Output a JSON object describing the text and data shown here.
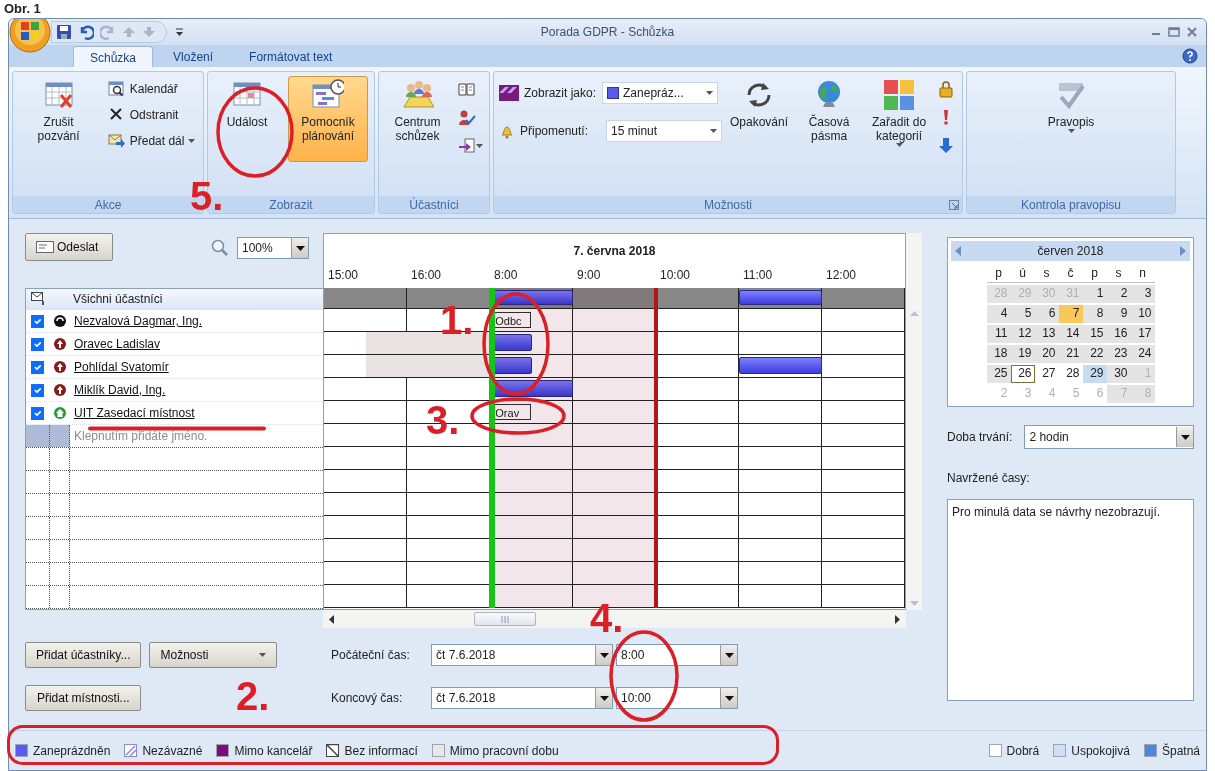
{
  "caption": "Obr. 1",
  "window": {
    "title": "Porada GDPR - Schůzka"
  },
  "tabs": [
    {
      "label": "Schůzka",
      "selected": true
    },
    {
      "label": "Vložení",
      "selected": false
    },
    {
      "label": "Formátovat text",
      "selected": false
    }
  ],
  "ribbon": {
    "groups": [
      {
        "label": "Akce",
        "items": [
          {
            "kind": "large",
            "label": "Zrušit pozvání"
          },
          {
            "kind": "small",
            "label": "Kalendář"
          },
          {
            "kind": "small",
            "label": "Odstranit"
          },
          {
            "kind": "small-split",
            "label": "Předat dál"
          }
        ]
      },
      {
        "label": "Zobrazit",
        "items": [
          {
            "kind": "large",
            "label": "Událost",
            "selected": false
          },
          {
            "kind": "large",
            "label": "Pomocník plánování",
            "selected": true
          }
        ]
      },
      {
        "label": "Účastníci",
        "items": [
          {
            "kind": "large",
            "label": "Centrum schůzek"
          },
          {
            "kind": "icon"
          },
          {
            "kind": "icon"
          },
          {
            "kind": "icon-split"
          }
        ]
      },
      {
        "label": "Možnosti",
        "items": [
          {
            "kind": "combo",
            "label": "Zobrazit jako:",
            "value": "Zanepráz..."
          },
          {
            "kind": "combo",
            "label": "Připomenutí:",
            "value": "15 minut"
          },
          {
            "kind": "large",
            "label": "Opakování"
          },
          {
            "kind": "large",
            "label": "Časová pásma"
          },
          {
            "kind": "large-split",
            "label": "Zařadit do kategorií"
          },
          {
            "kind": "icon"
          },
          {
            "kind": "icon"
          },
          {
            "kind": "icon"
          }
        ]
      },
      {
        "label": "Kontrola pravopisu",
        "items": [
          {
            "kind": "large-split",
            "label": "Pravopis"
          }
        ]
      }
    ]
  },
  "send_button": "Odeslat",
  "zoom": "100%",
  "attendees": {
    "header": "Všichni účastníci",
    "placeholder": "Klepnutím přidáte jméno.",
    "items": [
      {
        "name": "Nezvalová Dagmar, Ing.",
        "kind": "organizer",
        "checked": true
      },
      {
        "name": "Oravec Ladislav",
        "kind": "required",
        "checked": true
      },
      {
        "name": "Pohlídal Svatomír",
        "kind": "required",
        "checked": true
      },
      {
        "name": "Miklík David, Ing.",
        "kind": "required",
        "checked": true
      },
      {
        "name": "UIT Zasedací místnost",
        "kind": "resource",
        "checked": true
      }
    ]
  },
  "timeline": {
    "date": "7. června 2018",
    "hours": [
      "15:00",
      "16:00",
      "8:00",
      "9:00",
      "10:00",
      "11:00",
      "12:00"
    ],
    "rows": [
      {
        "kind": "all",
        "slots": [
          {
            "kind": "free"
          },
          {
            "kind": "free"
          },
          {
            "kind": "free"
          },
          {
            "kind": "free"
          },
          {
            "kind": "busy"
          },
          {
            "kind": "busy"
          },
          {
            "kind": "free"
          },
          {
            "kind": "free"
          },
          {
            "kind": "free"
          },
          {
            "kind": "free"
          },
          {
            "kind": "busy"
          },
          {
            "kind": "busy"
          },
          {
            "kind": "free"
          },
          {
            "kind": "free"
          }
        ]
      },
      {
        "kind": "attendee",
        "label": "Odbc",
        "slots": [
          {
            "kind": "free"
          },
          {
            "kind": "free"
          },
          {
            "kind": "free"
          },
          {
            "kind": "free"
          },
          {
            "kind": "label"
          },
          {
            "kind": "free"
          },
          {
            "kind": "free"
          },
          {
            "kind": "free"
          },
          {
            "kind": "free"
          },
          {
            "kind": "free"
          },
          {
            "kind": "free"
          },
          {
            "kind": "free"
          },
          {
            "kind": "free"
          },
          {
            "kind": "free"
          }
        ]
      },
      {
        "kind": "attendee",
        "slots": [
          {
            "kind": "free"
          },
          {
            "kind": "off"
          },
          {
            "kind": "off"
          },
          {
            "kind": "off"
          },
          {
            "kind": "busy"
          },
          {
            "kind": "free"
          },
          {
            "kind": "free"
          },
          {
            "kind": "free"
          },
          {
            "kind": "free"
          },
          {
            "kind": "free"
          },
          {
            "kind": "free"
          },
          {
            "kind": "free"
          },
          {
            "kind": "free"
          },
          {
            "kind": "free"
          }
        ]
      },
      {
        "kind": "attendee",
        "slots": [
          {
            "kind": "free"
          },
          {
            "kind": "off"
          },
          {
            "kind": "off"
          },
          {
            "kind": "off"
          },
          {
            "kind": "busy"
          },
          {
            "kind": "free"
          },
          {
            "kind": "free"
          },
          {
            "kind": "free"
          },
          {
            "kind": "free"
          },
          {
            "kind": "free"
          },
          {
            "kind": "busy"
          },
          {
            "kind": "busy"
          },
          {
            "kind": "free"
          },
          {
            "kind": "free"
          }
        ]
      },
      {
        "kind": "attendee",
        "slots": [
          {
            "kind": "free"
          },
          {
            "kind": "free"
          },
          {
            "kind": "free"
          },
          {
            "kind": "free"
          },
          {
            "kind": "busy"
          },
          {
            "kind": "busy"
          },
          {
            "kind": "free"
          },
          {
            "kind": "free"
          },
          {
            "kind": "free"
          },
          {
            "kind": "free"
          },
          {
            "kind": "free"
          },
          {
            "kind": "free"
          },
          {
            "kind": "free"
          },
          {
            "kind": "free"
          }
        ]
      },
      {
        "kind": "attendee",
        "label": "Orav",
        "slots": [
          {
            "kind": "free"
          },
          {
            "kind": "free"
          },
          {
            "kind": "free"
          },
          {
            "kind": "free"
          },
          {
            "kind": "label"
          },
          {
            "kind": "free"
          },
          {
            "kind": "free"
          },
          {
            "kind": "free"
          },
          {
            "kind": "free"
          },
          {
            "kind": "free"
          },
          {
            "kind": "free"
          },
          {
            "kind": "free"
          },
          {
            "kind": "free"
          },
          {
            "kind": "free"
          }
        ]
      }
    ]
  },
  "buttons": {
    "add_attendees": "Přidat účastníky...",
    "options": "Možnosti",
    "add_rooms": "Přidat místnosti..."
  },
  "times": [
    {
      "label": "Počáteční čas:",
      "date": "čt 7.6.2018",
      "time": "8:00"
    },
    {
      "label": "Koncový čas:",
      "date": "čt 7.6.2018",
      "time": "10:00"
    }
  ],
  "calendar": {
    "month": "červen 2018",
    "weekdays": [
      "p",
      "ú",
      "s",
      "č",
      "p",
      "s",
      "n"
    ],
    "weeks": [
      [
        {
          "day": "28",
          "kind": "other",
          "selected": false
        },
        {
          "day": "29",
          "kind": "other",
          "selected": false
        },
        {
          "day": "30",
          "kind": "other",
          "selected": false
        },
        {
          "day": "31",
          "kind": "other",
          "selected": false
        },
        {
          "day": "1",
          "kind": "day",
          "selected": false
        },
        {
          "day": "2",
          "kind": "day",
          "selected": false
        },
        {
          "day": "3",
          "kind": "day",
          "selected": false
        }
      ],
      [
        {
          "day": "4",
          "kind": "day",
          "selected": false
        },
        {
          "day": "5",
          "kind": "day",
          "selected": false
        },
        {
          "day": "6",
          "kind": "day",
          "selected": false
        },
        {
          "day": "7",
          "kind": "day",
          "selected": true
        },
        {
          "day": "8",
          "kind": "day",
          "selected": false
        },
        {
          "day": "9",
          "kind": "day",
          "selected": false
        },
        {
          "day": "10",
          "kind": "day",
          "selected": false
        }
      ],
      [
        {
          "day": "11",
          "kind": "day",
          "selected": false
        },
        {
          "day": "12",
          "kind": "day",
          "selected": false
        },
        {
          "day": "13",
          "kind": "day",
          "selected": false
        },
        {
          "day": "14",
          "kind": "day",
          "selected": false
        },
        {
          "day": "15",
          "kind": "day",
          "selected": false
        },
        {
          "day": "16",
          "kind": "day",
          "selected": false
        },
        {
          "day": "17",
          "kind": "day",
          "selected": false
        }
      ],
      [
        {
          "day": "18",
          "kind": "day",
          "selected": false
        },
        {
          "day": "19",
          "kind": "day",
          "selected": false
        },
        {
          "day": "20",
          "kind": "day",
          "selected": false
        },
        {
          "day": "21",
          "kind": "day",
          "selected": false
        },
        {
          "day": "22",
          "kind": "day",
          "selected": false
        },
        {
          "day": "23",
          "kind": "day",
          "selected": false
        },
        {
          "day": "24",
          "kind": "day",
          "selected": false
        }
      ],
      [
        {
          "day": "25",
          "kind": "day",
          "selected": false
        },
        {
          "day": "26",
          "kind": "today",
          "selected": false
        },
        {
          "day": "27",
          "kind": "plain",
          "selected": false
        },
        {
          "day": "28",
          "kind": "plain",
          "selected": false
        },
        {
          "day": "29",
          "kind": "marked",
          "selected": false
        },
        {
          "day": "30",
          "kind": "day",
          "selected": false
        },
        {
          "day": "1",
          "kind": "other",
          "selected": false
        }
      ],
      [
        {
          "day": "2",
          "kind": "other-plain",
          "selected": false
        },
        {
          "day": "3",
          "kind": "other-plain",
          "selected": false
        },
        {
          "day": "4",
          "kind": "other-plain",
          "selected": false
        },
        {
          "day": "5",
          "kind": "other-plain",
          "selected": false
        },
        {
          "day": "6",
          "kind": "other-plain",
          "selected": false
        },
        {
          "day": "7",
          "kind": "other",
          "selected": false
        },
        {
          "day": "8",
          "kind": "other",
          "selected": false
        }
      ]
    ]
  },
  "duration": {
    "label": "Doba trvání:",
    "value": "2 hodin"
  },
  "suggestions": {
    "label": "Navržené časy:",
    "text": "Pro minulá data se návrhy nezobrazují."
  },
  "legend": [
    {
      "label": "Zaneprázdněn",
      "kind": "solid",
      "color": "#5b5bf0"
    },
    {
      "label": "Nezávazné",
      "kind": "hatched",
      "color": "#8a8ad8"
    },
    {
      "label": "Mimo kancelář",
      "kind": "solid",
      "color": "#7b0d7b"
    },
    {
      "label": "Bez informací",
      "kind": "cross",
      "color": "#444444"
    },
    {
      "label": "Mimo pracovní dobu",
      "kind": "solid",
      "color": "#ebe7e7"
    }
  ],
  "quality_legend": [
    {
      "label": "Dobrá",
      "color": "#ffffff"
    },
    {
      "label": "Uspokojivá",
      "color": "#cfe0f5"
    },
    {
      "label": "Špatná",
      "color": "#4f86dc"
    }
  ],
  "annotations": [
    {
      "label": "5."
    },
    {
      "label": "1."
    },
    {
      "label": "3."
    },
    {
      "label": "4."
    },
    {
      "label": "2."
    }
  ]
}
